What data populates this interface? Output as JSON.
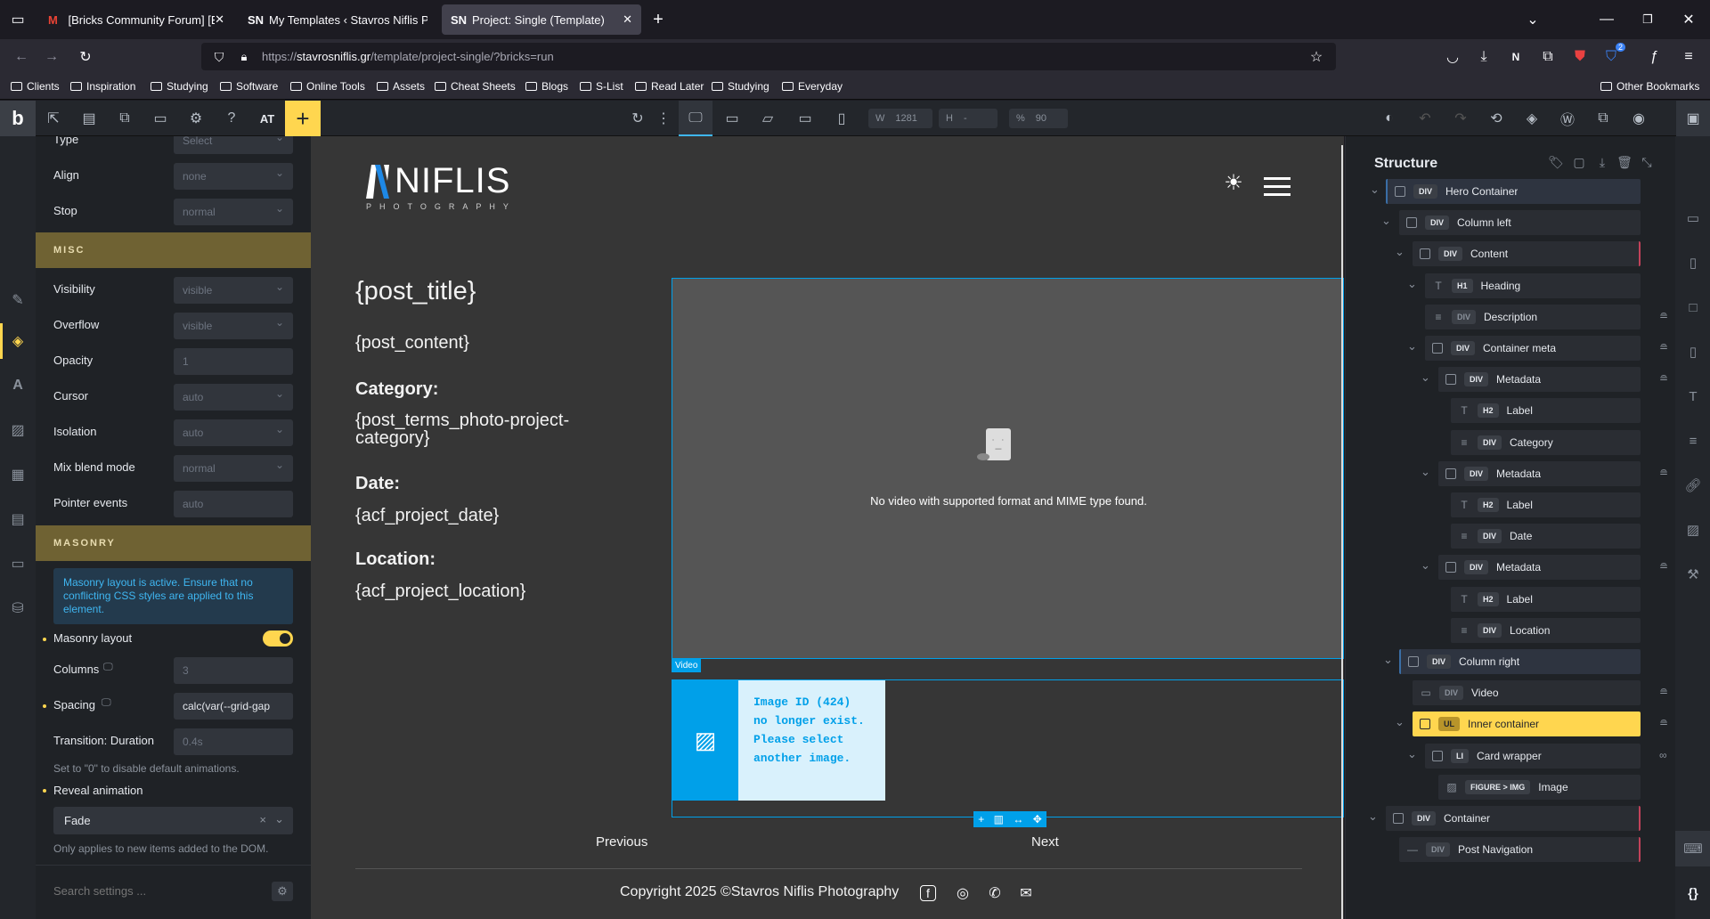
{
  "browser": {
    "tabs": [
      {
        "icon": "M",
        "title": "[Bricks Community Forum] [Bug"
      },
      {
        "icon": "SN",
        "title": "My Templates ‹ Stavros Niflis Ph"
      },
      {
        "icon": "SN",
        "title": "Project: Single (Template)"
      }
    ],
    "url_prefix": "https://",
    "url_domain": "stavrosniflis.gr",
    "url_path": "/template/project-single/?bricks=run",
    "bookmarks": [
      "Clients",
      "Inspiration",
      "Studying",
      "Software",
      "Online Tools",
      "Assets",
      "Cheat Sheets",
      "Blogs",
      "S-List",
      "Read Later",
      "Studying",
      "Everyday"
    ],
    "other_bookmarks": "Other Bookmarks",
    "ext_badge": "2"
  },
  "builder": {
    "logo": "b",
    "at": "AT",
    "width_label": "W",
    "width_value": "1281",
    "height_label": "H",
    "height_value": "-",
    "zoom_label": "%",
    "zoom_value": "90"
  },
  "settings": {
    "rows_top": [
      {
        "label": "Type",
        "value": "Select"
      },
      {
        "label": "Align",
        "value": "none"
      },
      {
        "label": "Stop",
        "value": "normal"
      }
    ],
    "misc_title": "MISC",
    "misc": [
      {
        "label": "Visibility",
        "value": "visible"
      },
      {
        "label": "Overflow",
        "value": "visible"
      },
      {
        "label": "Opacity",
        "value": "1"
      },
      {
        "label": "Cursor",
        "value": "auto"
      },
      {
        "label": "Isolation",
        "value": "auto"
      },
      {
        "label": "Mix blend mode",
        "value": "normal"
      },
      {
        "label": "Pointer events",
        "value": "auto"
      }
    ],
    "masonry_title": "MASONRY",
    "masonry_note": "Masonry layout is active. Ensure that no conflicting CSS styles are applied to this element.",
    "masonry_layout": "Masonry layout",
    "columns_label": "Columns",
    "columns_value": "3",
    "spacing_label": "Spacing",
    "spacing_value": "calc(var(--grid-gap",
    "transition_label": "Transition: Duration",
    "transition_value": "0.4s",
    "transition_hint": "Set to \"0\" to disable default animations.",
    "reveal_label": "Reveal animation",
    "reveal_value": "Fade",
    "reveal_hint": "Only applies to new items added to the DOM.",
    "search_placeholder": "Search settings ..."
  },
  "page": {
    "logo_text": "NIFLIS",
    "logo_sub": "PHOTOGRAPHY",
    "post_title": "{post_title}",
    "post_content": "{post_content}",
    "category_label": "Category:",
    "category_value": "{post_terms_photo-project-category}",
    "date_label": "Date:",
    "date_value": "{acf_project_date}",
    "location_label": "Location:",
    "location_value": "{acf_project_location}",
    "video_error": "No video with supported format and MIME type found.",
    "video_tag": "Video",
    "image_error": "Image ID (424) no longer exist. Please select another image.",
    "prev": "Previous",
    "next": "Next",
    "copyright": "Copyright 2025 ©Stavros Niflis Photography"
  },
  "structure": {
    "title": "Structure",
    "items": [
      {
        "tag": "DIV",
        "label": "Hero Container"
      },
      {
        "tag": "DIV",
        "label": "Column left"
      },
      {
        "tag": "DIV",
        "label": "Content"
      },
      {
        "tag": "H1",
        "label": "Heading"
      },
      {
        "tag": "DIV",
        "label": "Description"
      },
      {
        "tag": "DIV",
        "label": "Container meta"
      },
      {
        "tag": "DIV",
        "label": "Metadata"
      },
      {
        "tag": "H2",
        "label": "Label"
      },
      {
        "tag": "DIV",
        "label": "Category"
      },
      {
        "tag": "DIV",
        "label": "Metadata"
      },
      {
        "tag": "H2",
        "label": "Label"
      },
      {
        "tag": "DIV",
        "label": "Date"
      },
      {
        "tag": "DIV",
        "label": "Metadata"
      },
      {
        "tag": "H2",
        "label": "Label"
      },
      {
        "tag": "DIV",
        "label": "Location"
      },
      {
        "tag": "DIV",
        "label": "Column right"
      },
      {
        "tag": "DIV",
        "label": "Video"
      },
      {
        "tag": "UL",
        "label": "Inner container"
      },
      {
        "tag": "LI",
        "label": "Card wrapper"
      },
      {
        "tag": "FIGURE > IMG",
        "label": "Image"
      },
      {
        "tag": "DIV",
        "label": "Container"
      },
      {
        "tag": "DIV",
        "label": "Post Navigation"
      }
    ]
  },
  "colors": {
    "accent": "#ffd64f",
    "selection": "#00a0e9",
    "builder_bg": "#23262b"
  }
}
